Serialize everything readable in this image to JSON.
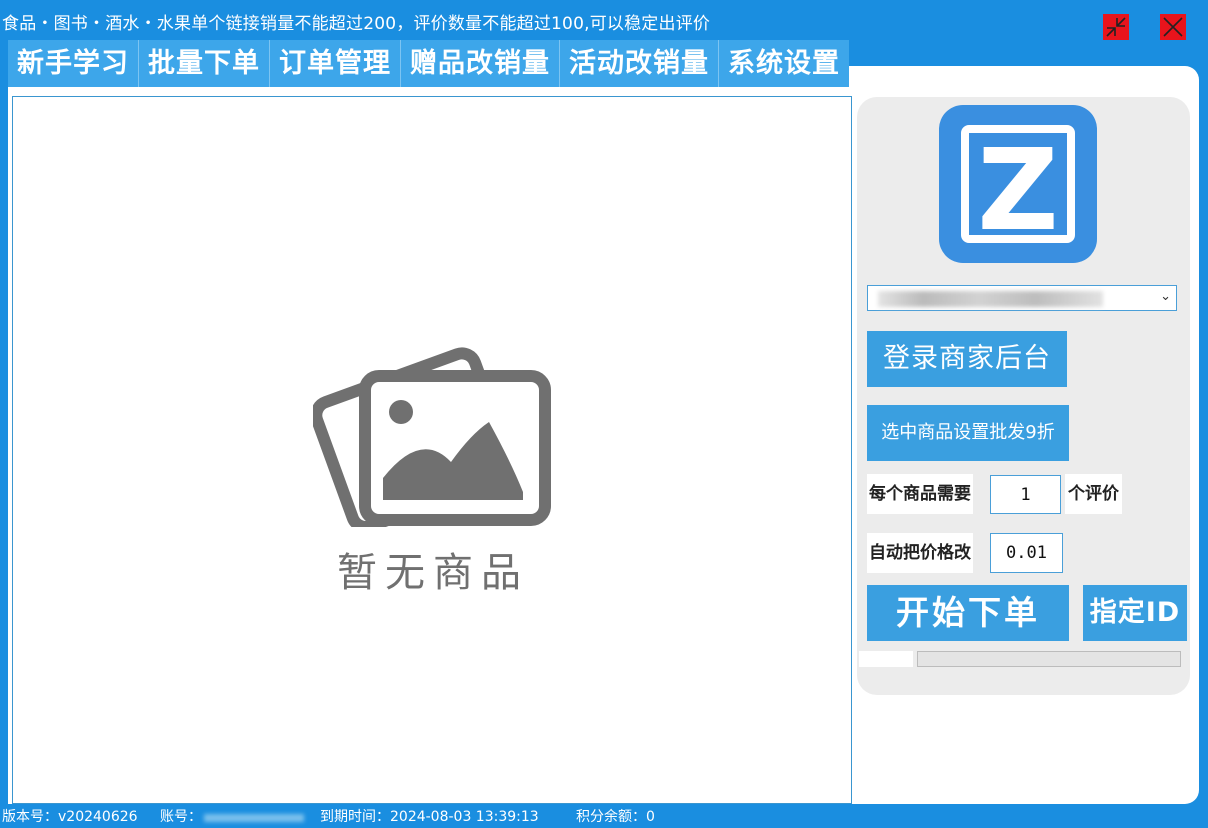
{
  "title_bar": {
    "notice": "食品・图书・酒水・水果单个链接销量不能超过200，评价数量不能超过100,可以稳定出评价",
    "restore_icon": "restore-arrows-icon",
    "close_icon": "close-x-icon",
    "button_color": "#e8141c"
  },
  "menu": {
    "items": [
      {
        "label": "新手学习"
      },
      {
        "label": "批量下单"
      },
      {
        "label": "订单管理"
      },
      {
        "label": "赠品改销量"
      },
      {
        "label": "活动改销量"
      },
      {
        "label": "系统设置"
      }
    ]
  },
  "product_panel": {
    "empty_text": "暂无商品",
    "empty_icon": "photo-stack-icon"
  },
  "side_panel": {
    "logo": {
      "letter": "Z",
      "icon": "z-logo-icon",
      "color": "#3a8fe0"
    },
    "account_select": {
      "icon": "chevron-down-icon"
    },
    "login_button": "登录商家后台",
    "discount_button": "选中商品设置批发9折",
    "reviews_label": "每个商品需要",
    "reviews_value": "1",
    "reviews_unit": "个评价",
    "price_label": "自动把价格改",
    "price_value": "0.01",
    "start_button": "开始下单",
    "specify_button": "指定ID",
    "progress": 0
  },
  "status_bar": {
    "version": "版本号：v20240626",
    "account_label": "账号：",
    "expiry": "到期时间：2024-08-03 13:39:13",
    "points": "积分余额：0"
  },
  "colors": {
    "primary": "#1a8ee0",
    "button": "#3a9fe0",
    "panel_bg": "#ececec"
  }
}
